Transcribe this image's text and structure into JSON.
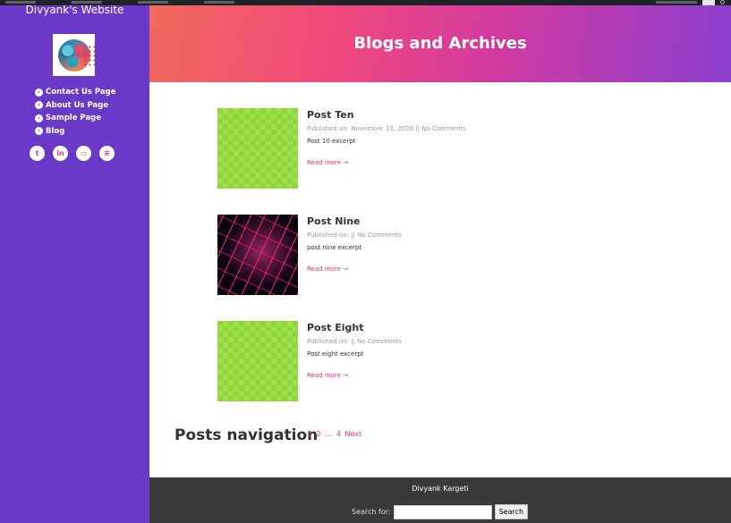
{
  "site": {
    "title": "Divyank's Website"
  },
  "sidebar": {
    "nav": [
      {
        "label": "Contact Us Page"
      },
      {
        "label": "About Us Page"
      },
      {
        "label": "Sample Page"
      },
      {
        "label": "Blog"
      }
    ],
    "social": [
      {
        "icon": "twitter-icon",
        "glyph": "t"
      },
      {
        "icon": "linkedin-icon",
        "glyph": "in"
      },
      {
        "icon": "print-icon",
        "glyph": "▭"
      },
      {
        "icon": "stackoverflow-icon",
        "glyph": "≡"
      }
    ],
    "background": "#6b39c7"
  },
  "header": {
    "title": "Blogs and Archives"
  },
  "posts": [
    {
      "title": "Post Ten",
      "meta": "Published on: November 15, 2020 || No Comments",
      "excerpt": "Post 10 excerpt",
      "read_more": "Read more →",
      "thumbnail": "placeholder-checker"
    },
    {
      "title": "Post Nine",
      "meta": "Published on: || No Comments",
      "excerpt": "post nine excerpt",
      "read_more": "Read more →",
      "thumbnail": "keyboard-photo"
    },
    {
      "title": "Post Eight",
      "meta": "Published on: || No Comments",
      "excerpt": "Post eight excerpt",
      "read_more": "Read more →",
      "thumbnail": "placeholder-checker"
    }
  ],
  "posts_navigation": {
    "label": "Posts navigation",
    "page_1": "1",
    "page_2": "2",
    "ellipsis": "…",
    "page_4": "4",
    "next": "Next"
  },
  "footer": {
    "name": "Divyank Kargeti",
    "search_label": "Search for:",
    "search_value": "",
    "search_button": "Search"
  },
  "colors": {
    "accent": "#e2367a",
    "footer": "#3a3a3a"
  }
}
